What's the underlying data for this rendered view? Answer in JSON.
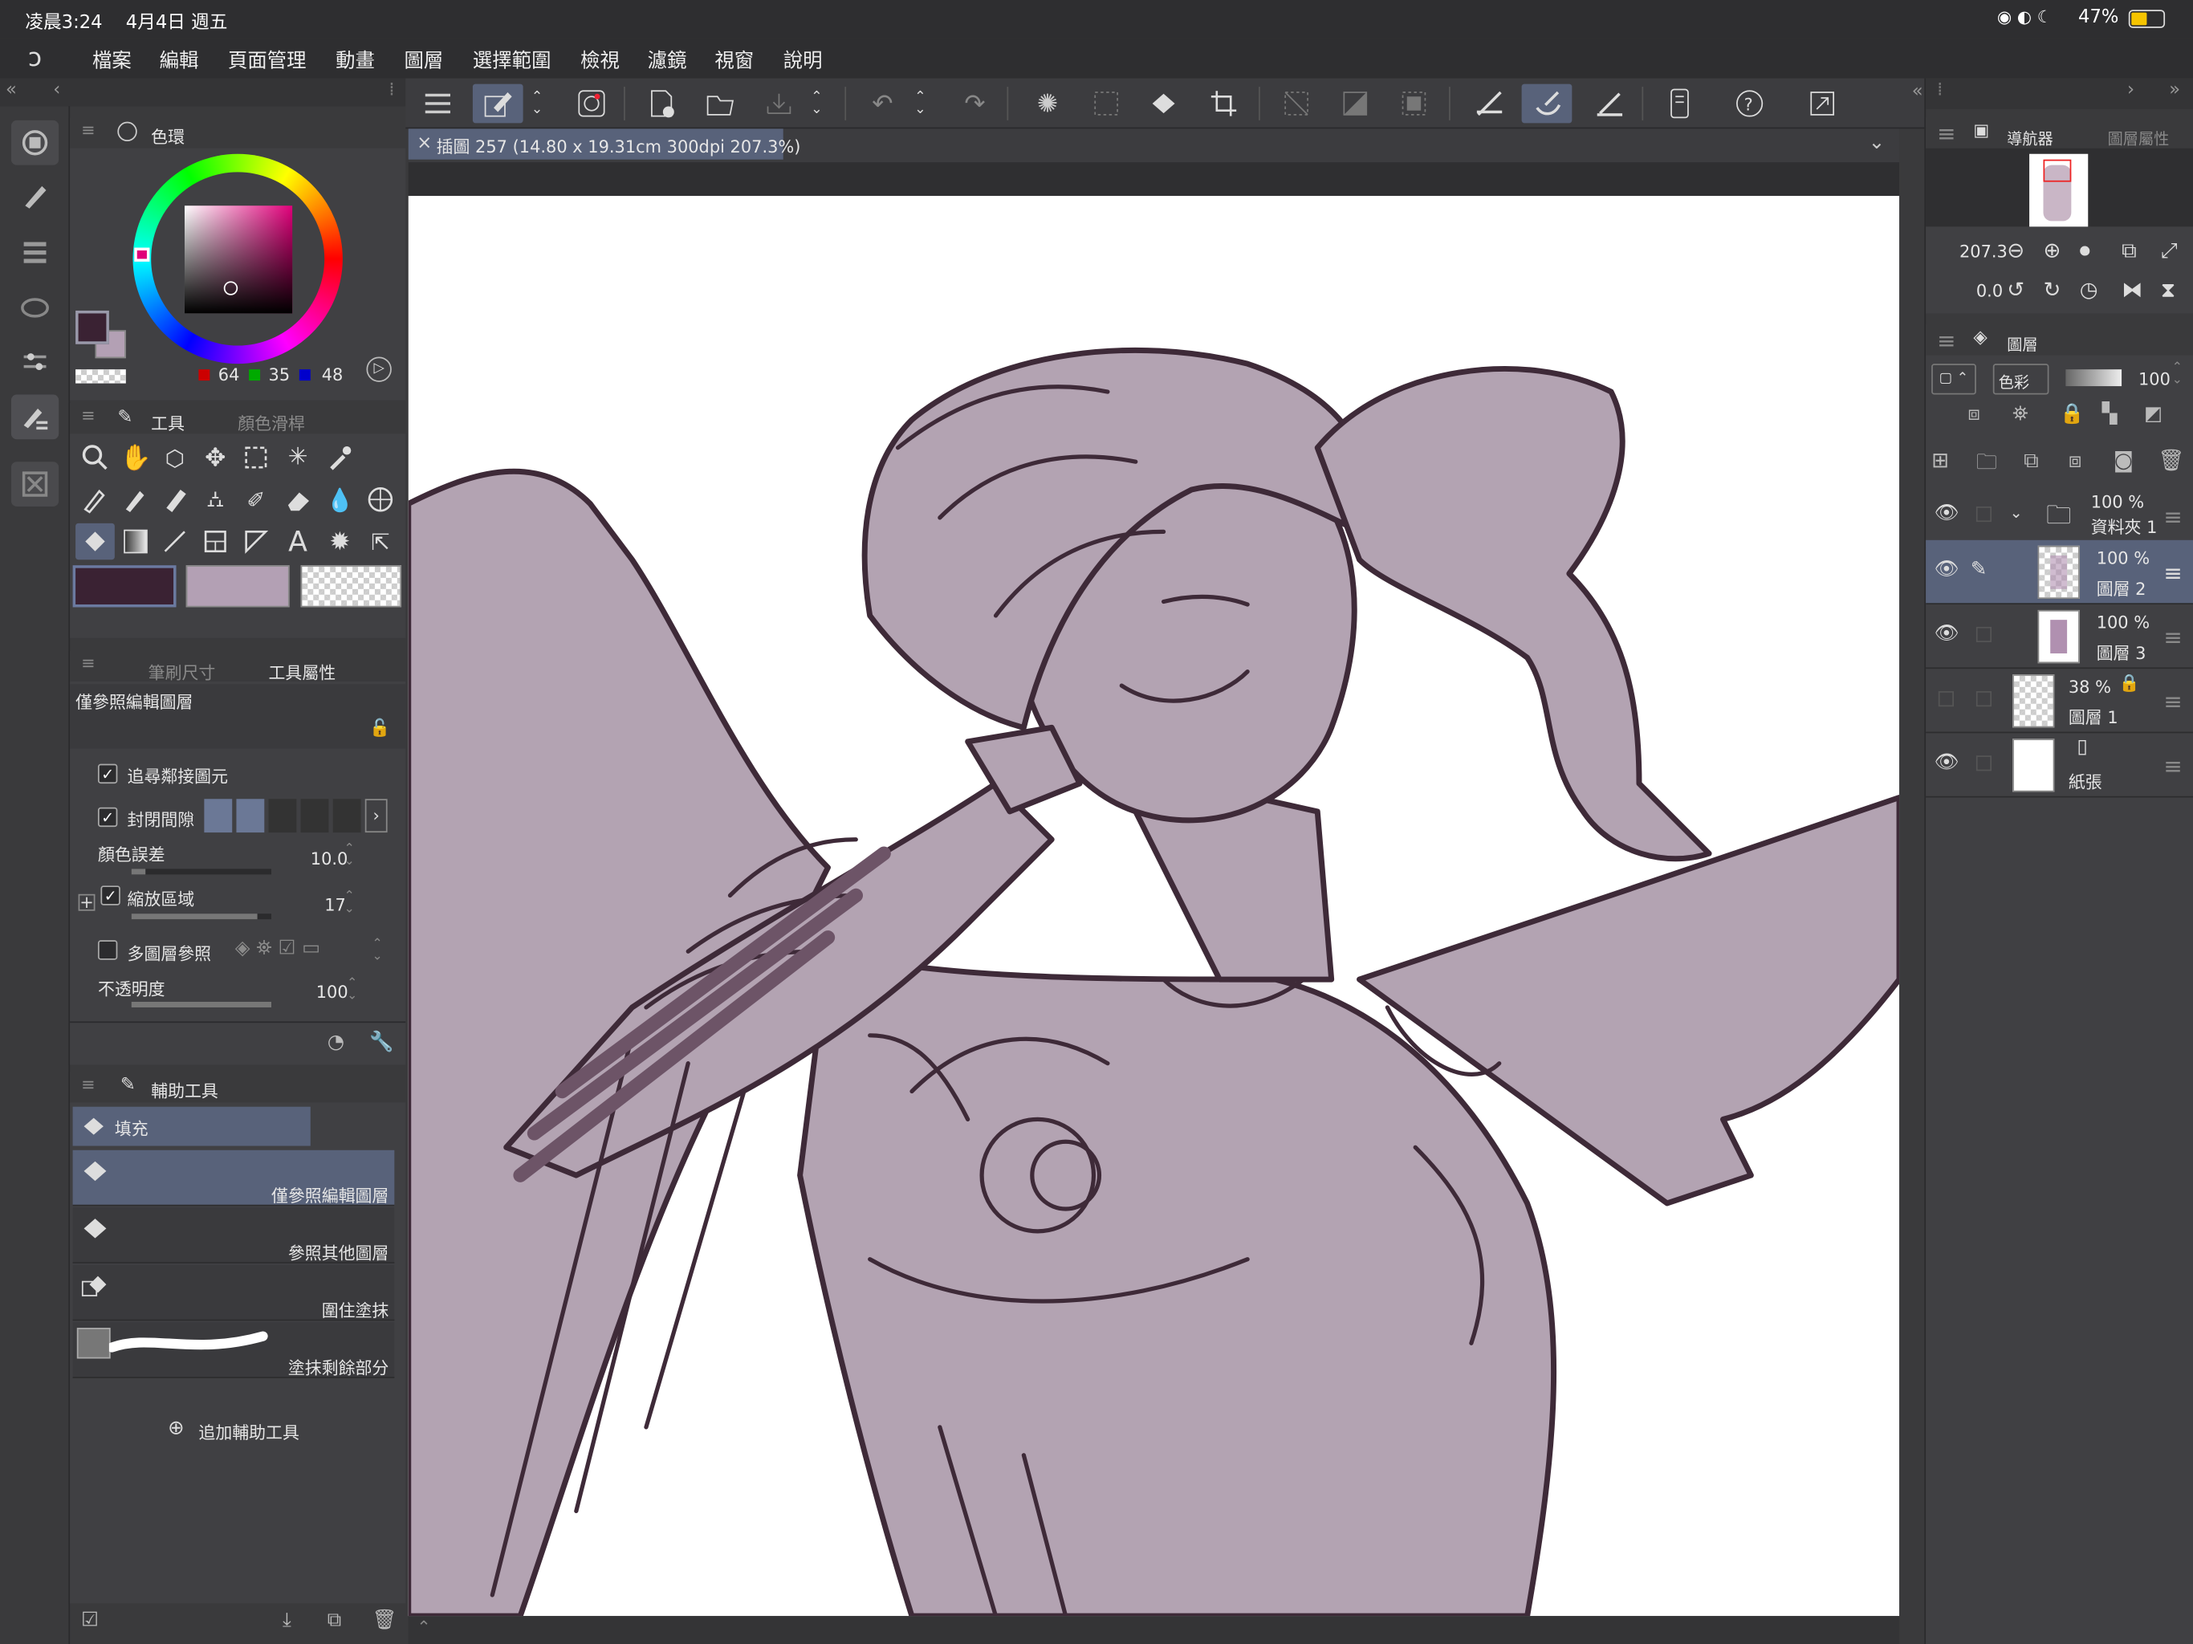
{
  "status": {
    "time": "凌晨3:24",
    "date": "4月4日 週五",
    "battery": "47%"
  },
  "menu": [
    "檔案",
    "編輯",
    "頁面管理",
    "動畫",
    "圖層",
    "選擇範圍",
    "檢視",
    "濾鏡",
    "視窗",
    "說明"
  ],
  "document_tab": {
    "title": "插圖 257 (14.80 x 19.31cm 300dpi 207.3%)"
  },
  "color_wheel": {
    "panel_title": "色環",
    "main_color": "#3a2233",
    "sub_color": "#b3a0b4",
    "rgb": {
      "r": "64",
      "g": "35",
      "b": "48"
    }
  },
  "tool_panel": {
    "title": "工具",
    "tab2": "顏色滑桿"
  },
  "tool_property": {
    "tab1": "筆刷尺寸",
    "tab2": "工具屬性",
    "subtool_name": "僅參照編輯圖層",
    "trace_adjacent": "追尋鄰接圖元",
    "close_gap": "封閉間隙",
    "color_margin_label": "顏色誤差",
    "color_margin_value": "10.0",
    "scale_area_label": "縮放區域",
    "scale_area_value": "17",
    "multi_layer_ref": "多圖層參照",
    "opacity_label": "不透明度",
    "opacity_value": "100"
  },
  "subtool_panel": {
    "title": "輔助工具",
    "group": "填充",
    "items": [
      "僅參照編輯圖層",
      "參照其他圖層",
      "圍住塗抹",
      "塗抹剩餘部分"
    ],
    "add_label": "追加輔助工具"
  },
  "navigator": {
    "tab1": "導航器",
    "tab2": "圖層屬性",
    "zoom": "207.3",
    "rotation": "0.0"
  },
  "layer_panel": {
    "title": "圖層",
    "blend_mode": "色彩",
    "opacity": "100",
    "layers": [
      {
        "opacity": "100 %",
        "name": "資料夾 1"
      },
      {
        "opacity": "100 %",
        "name": "圖層 2"
      },
      {
        "opacity": "100 %",
        "name": "圖層 3"
      },
      {
        "opacity": "38 %",
        "name": "圖層 1"
      },
      {
        "opacity": "",
        "name": "紙張"
      }
    ]
  },
  "colors": {
    "accent": "#58627a",
    "panel": "#404043",
    "sketch_fill": "#b3a3b2",
    "line": "#3e2a38"
  }
}
